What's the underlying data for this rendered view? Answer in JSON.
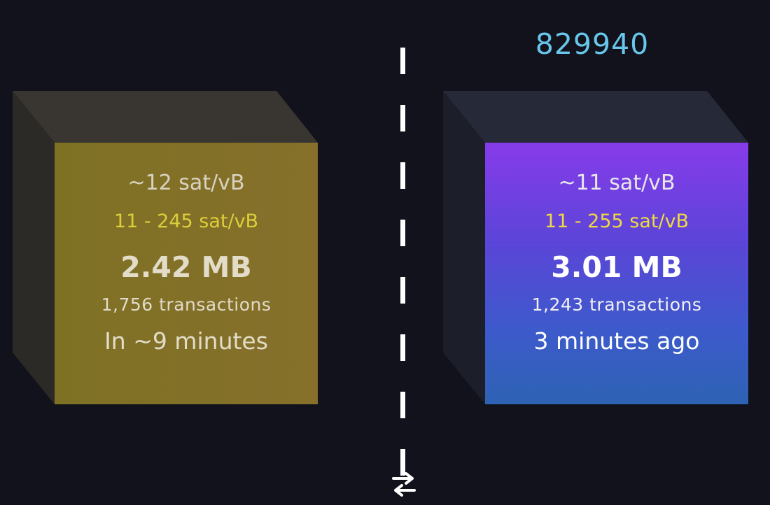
{
  "next_block": {
    "median_fee": "~12 sat/vB",
    "fee_range": "11 - 245 sat/vB",
    "size": "2.42 MB",
    "transactions": "1,756 transactions",
    "time": "In ~9 minutes"
  },
  "latest_block": {
    "height": "829940",
    "median_fee": "~11 sat/vB",
    "fee_range": "11 - 255 sat/vB",
    "size": "3.01 MB",
    "transactions": "1,243 transactions",
    "time": "3 minutes ago"
  },
  "icons": {
    "divider_toggle": "swap-arrows-icon"
  },
  "colors": {
    "background": "#11121b",
    "block_height": "#68c6ea",
    "fee_range": "#eeda43",
    "mempool_block_front": "#80712a",
    "mined_block_top": "#873bea",
    "mined_block_bottom": "#2d63b3"
  }
}
